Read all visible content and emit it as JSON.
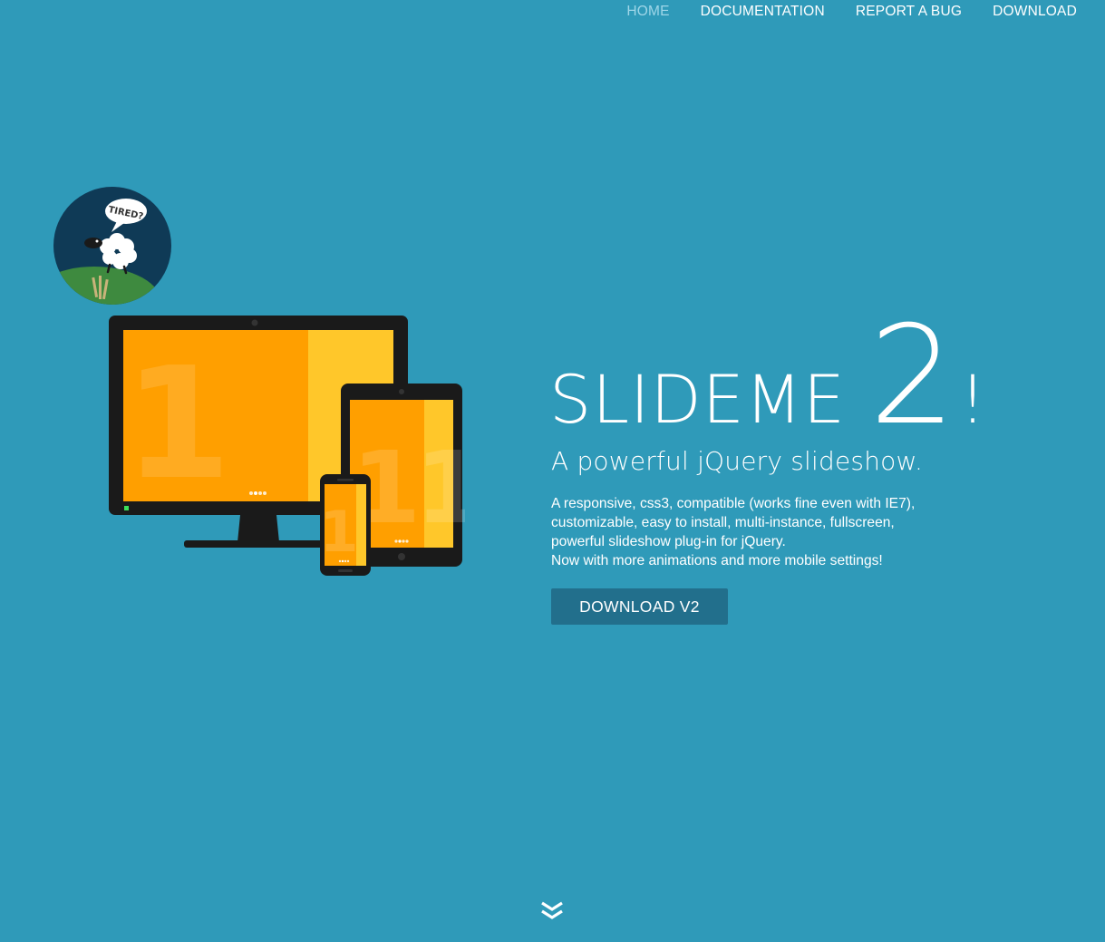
{
  "nav": {
    "items": [
      {
        "label": "HOME",
        "active": true
      },
      {
        "label": "DOCUMENTATION",
        "active": false
      },
      {
        "label": "REPORT A BUG",
        "active": false
      },
      {
        "label": "DOWNLOAD",
        "active": false
      }
    ]
  },
  "logo": {
    "icon": "sheep-icon",
    "speech_bubble_text": "TIRED?"
  },
  "devices": {
    "slide_number": "1",
    "colors": {
      "primary": "#ff9f00",
      "secondary": "#ffc72a",
      "frame": "#1a1a1a"
    }
  },
  "hero": {
    "title_word": "SLIDEME",
    "title_number": "2",
    "title_suffix": "!",
    "subtitle": "A powerful jQuery slideshow.",
    "description_lines": [
      "A responsive, css3, compatible (works fine even with IE7),",
      "customizable, easy to install, multi-instance, fullscreen,",
      "powerful slideshow plug-in for jQuery.",
      "Now with more animations and more mobile settings!"
    ],
    "download_button": "DOWNLOAD V2"
  },
  "scroll_indicator": {
    "icon": "double-chevron-down-icon"
  },
  "colors": {
    "background": "#2f9ab9",
    "button": "#226f8c",
    "nav_active": "#9fd6e8",
    "logo_background": "#0f3a56"
  }
}
